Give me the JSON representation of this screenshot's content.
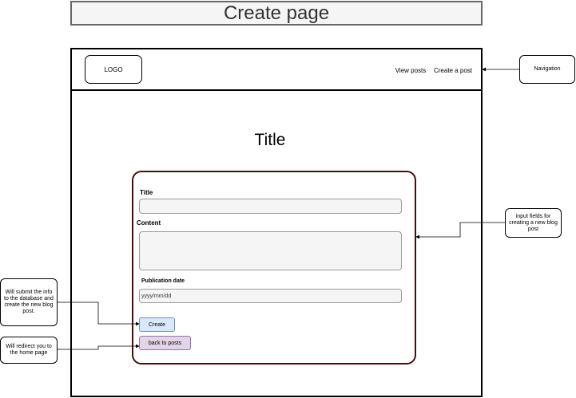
{
  "page_title": "Create page",
  "header": {
    "logo": "LOGO",
    "nav": [
      {
        "label": "View posts"
      },
      {
        "label": "Create a post"
      }
    ]
  },
  "main": {
    "title": "Title"
  },
  "form": {
    "title_label": "Title",
    "content_label": "Content",
    "date_label": "Publication date",
    "date_placeholder": "yyyy/mm/dd",
    "create_button": "Create",
    "back_button": "back to posts"
  },
  "annotations": {
    "navigation": "Navigation",
    "input_fields": "input fields for creating a new blog post",
    "submit": "Will submit the info to the database and create the new blog post.",
    "redirect": "Will redirect you to the home page"
  },
  "colors": {
    "card_border": "#4a0d0d",
    "create_fill": "#dae8fc",
    "create_stroke": "#6c8ebf",
    "back_fill": "#e1d5e7",
    "back_stroke": "#9673a6"
  }
}
